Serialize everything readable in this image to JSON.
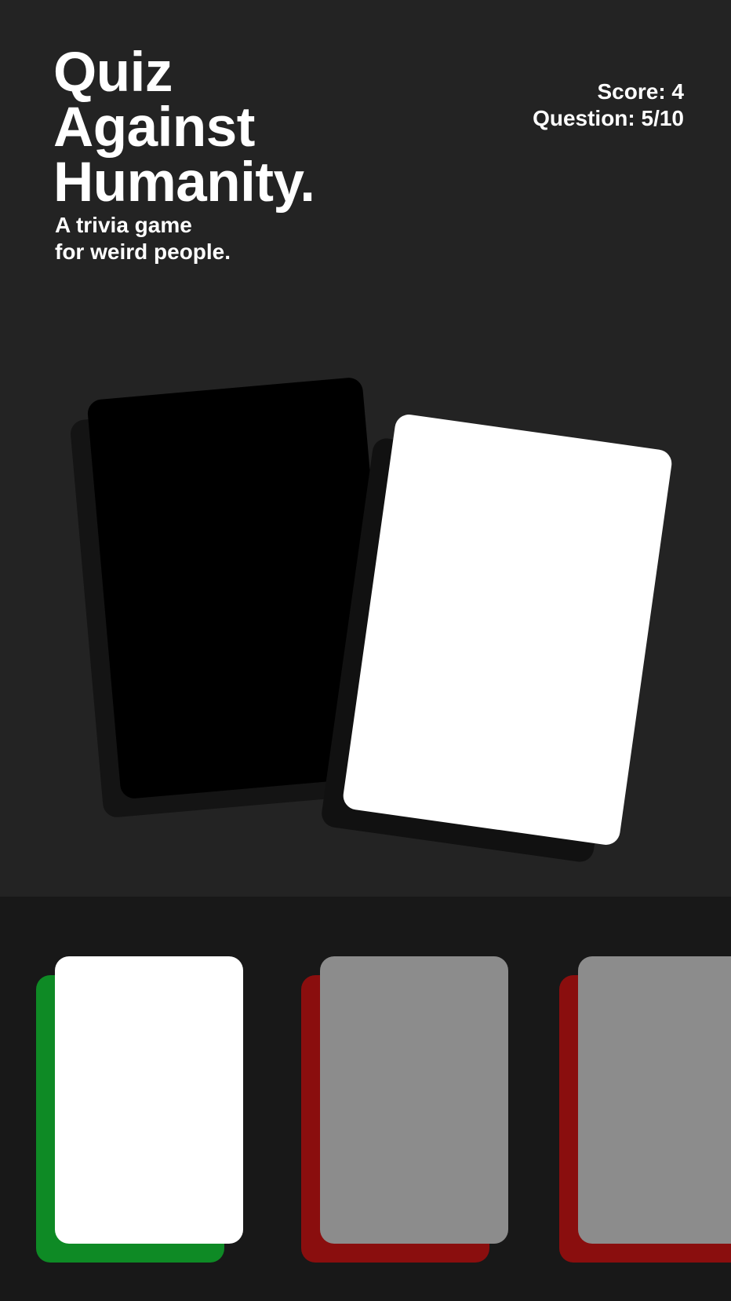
{
  "header": {
    "title_lines": [
      "Quiz",
      "Against",
      "Humanity."
    ],
    "subtitle_lines": [
      "A trivia game",
      "for weird people."
    ]
  },
  "stats": {
    "score_text": "Score: 4",
    "question_text": "Question: 5/10",
    "score": 4,
    "question_current": 5,
    "question_total": 10
  },
  "colors": {
    "background": "#232323",
    "tray_background": "#181818",
    "black_card": "#000000",
    "white_card": "#ffffff",
    "correct": "#0e8a25",
    "incorrect": "#8a0e0e",
    "dimmed_card": "#8c8c8c"
  },
  "answer_choices": [
    {
      "state": "correct",
      "face_color": "#ffffff",
      "back_color": "#0e8a25"
    },
    {
      "state": "incorrect",
      "face_color": "#8c8c8c",
      "back_color": "#8a0e0e"
    },
    {
      "state": "incorrect",
      "face_color": "#8c8c8c",
      "back_color": "#8a0e0e"
    }
  ]
}
